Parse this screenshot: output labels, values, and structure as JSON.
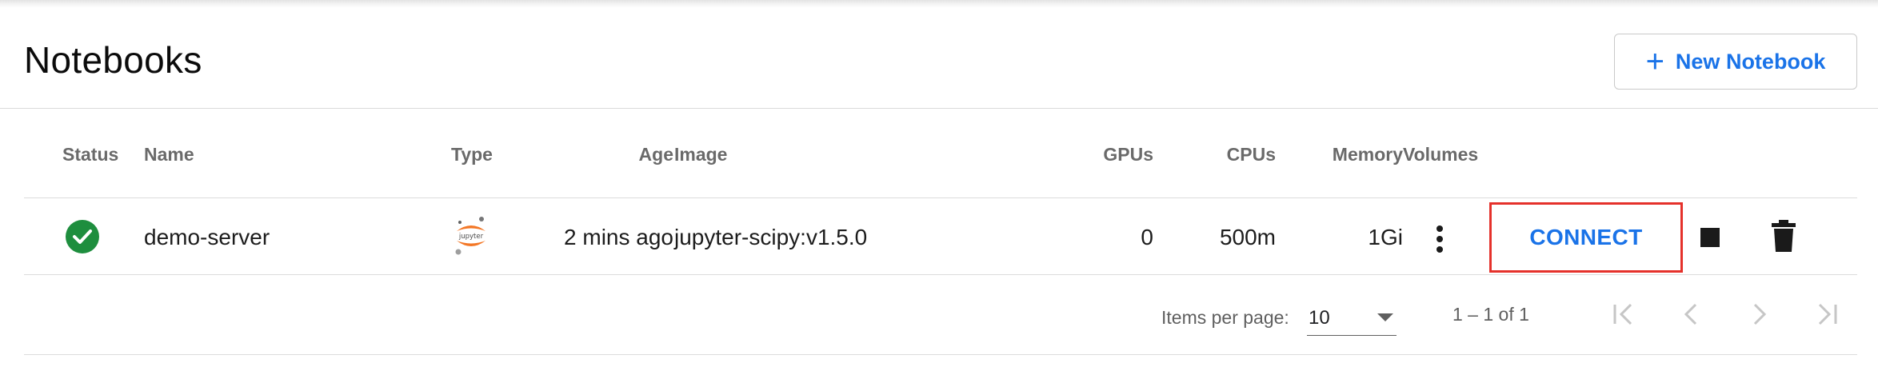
{
  "header": {
    "title": "Notebooks",
    "new_button_icon": "plus-icon",
    "new_button_label": "New Notebook"
  },
  "table": {
    "columns": {
      "status": "Status",
      "name": "Name",
      "type": "Type",
      "age": "Age",
      "image": "Image",
      "gpus": "GPUs",
      "cpus": "CPUs",
      "memory": "Memory",
      "volumes": "Volumes"
    },
    "rows": [
      {
        "status_icon": "check-circle-icon",
        "name": "demo-server",
        "type_icon": "jupyter-logo-icon",
        "type_logo_text": "jupyter",
        "age": "2 mins ago",
        "image": "jupyter-scipy:v1.5.0",
        "gpus": "0",
        "cpus": "500m",
        "memory": "1Gi",
        "volumes_icon": "more-vert-icon",
        "connect_label": "CONNECT",
        "stop_icon": "stop-icon",
        "delete_icon": "delete-icon"
      }
    ]
  },
  "paginator": {
    "items_per_page_label": "Items per page:",
    "items_per_page_value": "10",
    "range_label": "1 – 1 of 1",
    "first_icon": "first-page-icon",
    "prev_icon": "chevron-left-icon",
    "next_icon": "chevron-right-icon",
    "last_icon": "last-page-icon"
  },
  "colors": {
    "accent": "#1a73e8",
    "status_ok": "#1e8e3e",
    "highlight_border": "#e5312b",
    "jupyter_orange": "#f37726"
  }
}
